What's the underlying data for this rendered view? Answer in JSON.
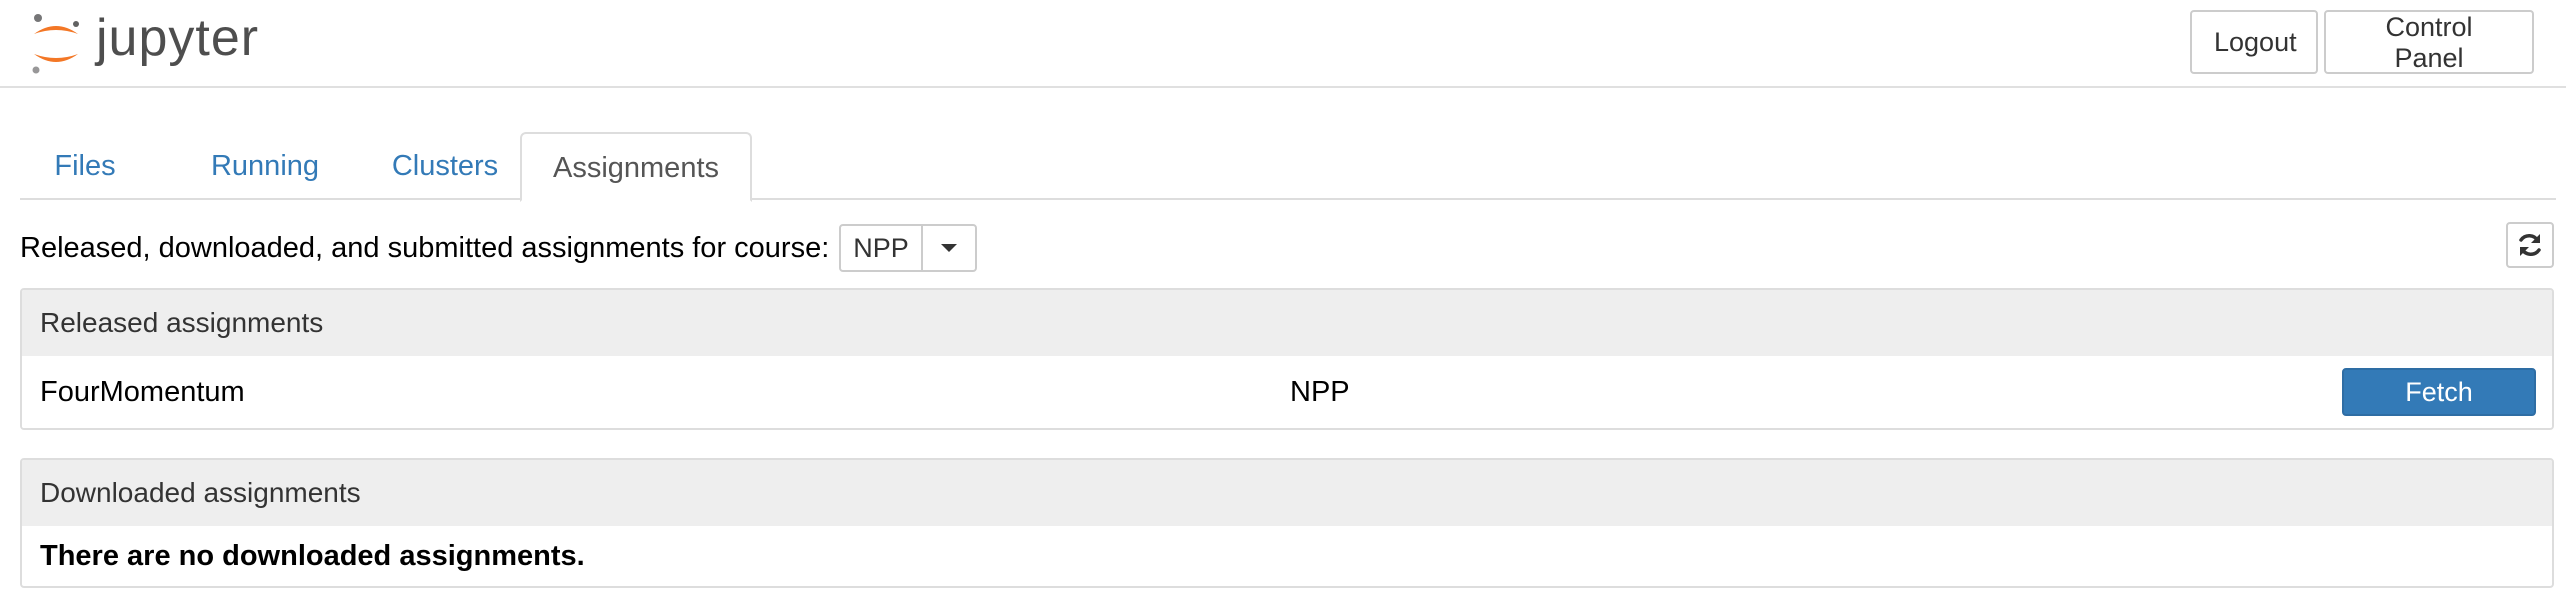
{
  "app": {
    "logo_text": "jupyter"
  },
  "header": {
    "logout_label": "Logout",
    "control_panel_label": "Control Panel"
  },
  "tabs": [
    {
      "label": "Files",
      "active": false
    },
    {
      "label": "Running",
      "active": false
    },
    {
      "label": "Clusters",
      "active": false
    },
    {
      "label": "Assignments",
      "active": true
    }
  ],
  "course_selector": {
    "label": "Released, downloaded, and submitted assignments for course:",
    "selected": "NPP"
  },
  "released": {
    "heading": "Released assignments",
    "rows": [
      {
        "name": "FourMomentum",
        "course": "NPP",
        "action_label": "Fetch"
      }
    ]
  },
  "downloaded": {
    "heading": "Downloaded assignments",
    "empty_message": "There are no downloaded assignments."
  },
  "colors": {
    "accent": "#337ab7",
    "logo_orange": "#f37726",
    "panel_heading_bg": "#eeeeee"
  },
  "icons": {
    "refresh": "refresh-icon",
    "caret": "caret-down-icon",
    "logo": "jupyter-logo-icon"
  }
}
